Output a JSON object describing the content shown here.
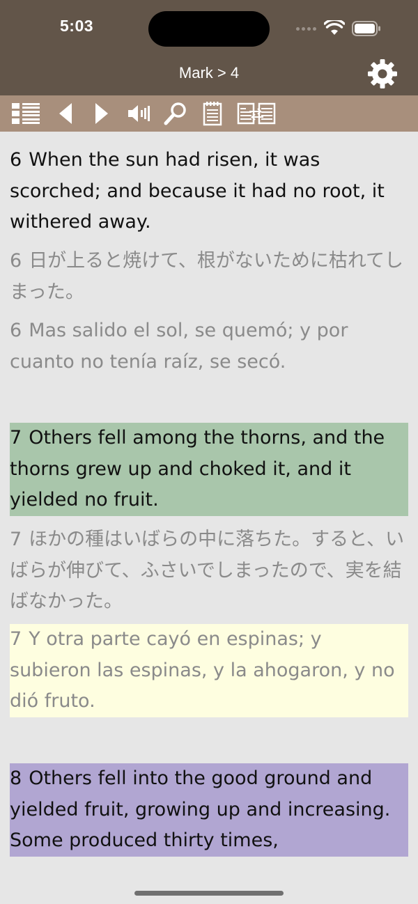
{
  "status_bar": {
    "time": "5:03"
  },
  "nav": {
    "title": "Mark > 4"
  },
  "toolbar": {
    "icons": [
      "list-icon",
      "back-arrow-icon",
      "forward-arrow-icon",
      "speaker-icon",
      "search-icon",
      "notepad-icon",
      "compare-icon"
    ]
  },
  "colors": {
    "header": "#625549",
    "toolbar": "#a88f7c",
    "highlight_green": "#a9c6ab",
    "highlight_yellow": "#fefee0",
    "highlight_purple": "#b1a6d2"
  },
  "verses": [
    {
      "number": "6",
      "en": "When the sun had risen, it was scorched; and because it had no root, it withered away.",
      "jp": "日が上ると焼けて、根がないために枯れてしまった。",
      "es": "Mas salido el sol, se quemó; y por cuanto no tenía raíz, se secó."
    },
    {
      "number": "7",
      "en": "Others fell among the thorns, and the thorns grew up and choked it, and it yielded no fruit.",
      "jp": "ほかの種はいばらの中に落ちた。すると、いばらが伸びて、ふさいでしまったので、実を結ばなかった。",
      "es": "Y otra parte cayó en espinas; y subieron las espinas, y la ahogaron, y no dió fruto."
    },
    {
      "number": "8",
      "en": "Others fell into the good ground and yielded fruit, growing up and increasing. Some produced thirty times,"
    }
  ]
}
